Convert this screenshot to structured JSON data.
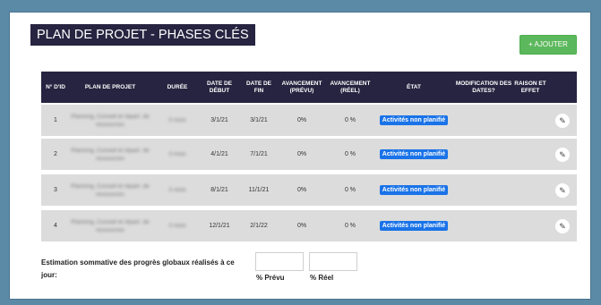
{
  "page": {
    "title": "PLAN DE PROJET - PHASES CLÉS",
    "add_button": "+ AJOUTER"
  },
  "table": {
    "headers": {
      "id": "N° D'ID",
      "plan": "PLAN DE PROJET",
      "duree": "DURÉE",
      "debut": "DATE DE DÉBUT",
      "fin": "DATE DE FIN",
      "prevu": "AVANCEMENT (PRÉVU)",
      "reel": "AVANCEMENT (RÉEL)",
      "etat": "ÉTAT",
      "modif": "MODIFICATION DES DATES?",
      "raison": "RAISON ET EFFET"
    },
    "rows": [
      {
        "id": "1",
        "plan": "Planning, Conseil et répart. de ressources",
        "duree": "3 mois",
        "debut": "3/1/21",
        "fin": "3/1/21",
        "prevu": "0%",
        "reel": "0 %",
        "etat": "Activités non planifié"
      },
      {
        "id": "2",
        "plan": "Planning, Conseil et répart. de ressources",
        "duree": "3 mois",
        "debut": "4/1/21",
        "fin": "7/1/21",
        "prevu": "0%",
        "reel": "0 %",
        "etat": "Activités non planifié"
      },
      {
        "id": "3",
        "plan": "Planning, Conseil et répart. de ressources",
        "duree": "3 mois",
        "debut": "8/1/21",
        "fin": "11/1/21",
        "prevu": "0%",
        "reel": "0 %",
        "etat": "Activités non planifié"
      },
      {
        "id": "4",
        "plan": "Planning, Conseil et répart. de ressources",
        "duree": "3 mois",
        "debut": "12/1/21",
        "fin": "2/1/22",
        "prevu": "0%",
        "reel": "0 %",
        "etat": "Activités non planifié"
      }
    ]
  },
  "summary": {
    "label": "Estimation sommative des progrès globaux réalisés à ce jour:",
    "prevu_label": "%  Prévu",
    "reel_label": "%   Réel"
  },
  "colors": {
    "header_bg": "#262440",
    "status_blue": "#1a73e8",
    "add_green": "#5cb85c",
    "background": "#5b8aa6"
  },
  "icons": {
    "edit": "pencil-icon"
  }
}
